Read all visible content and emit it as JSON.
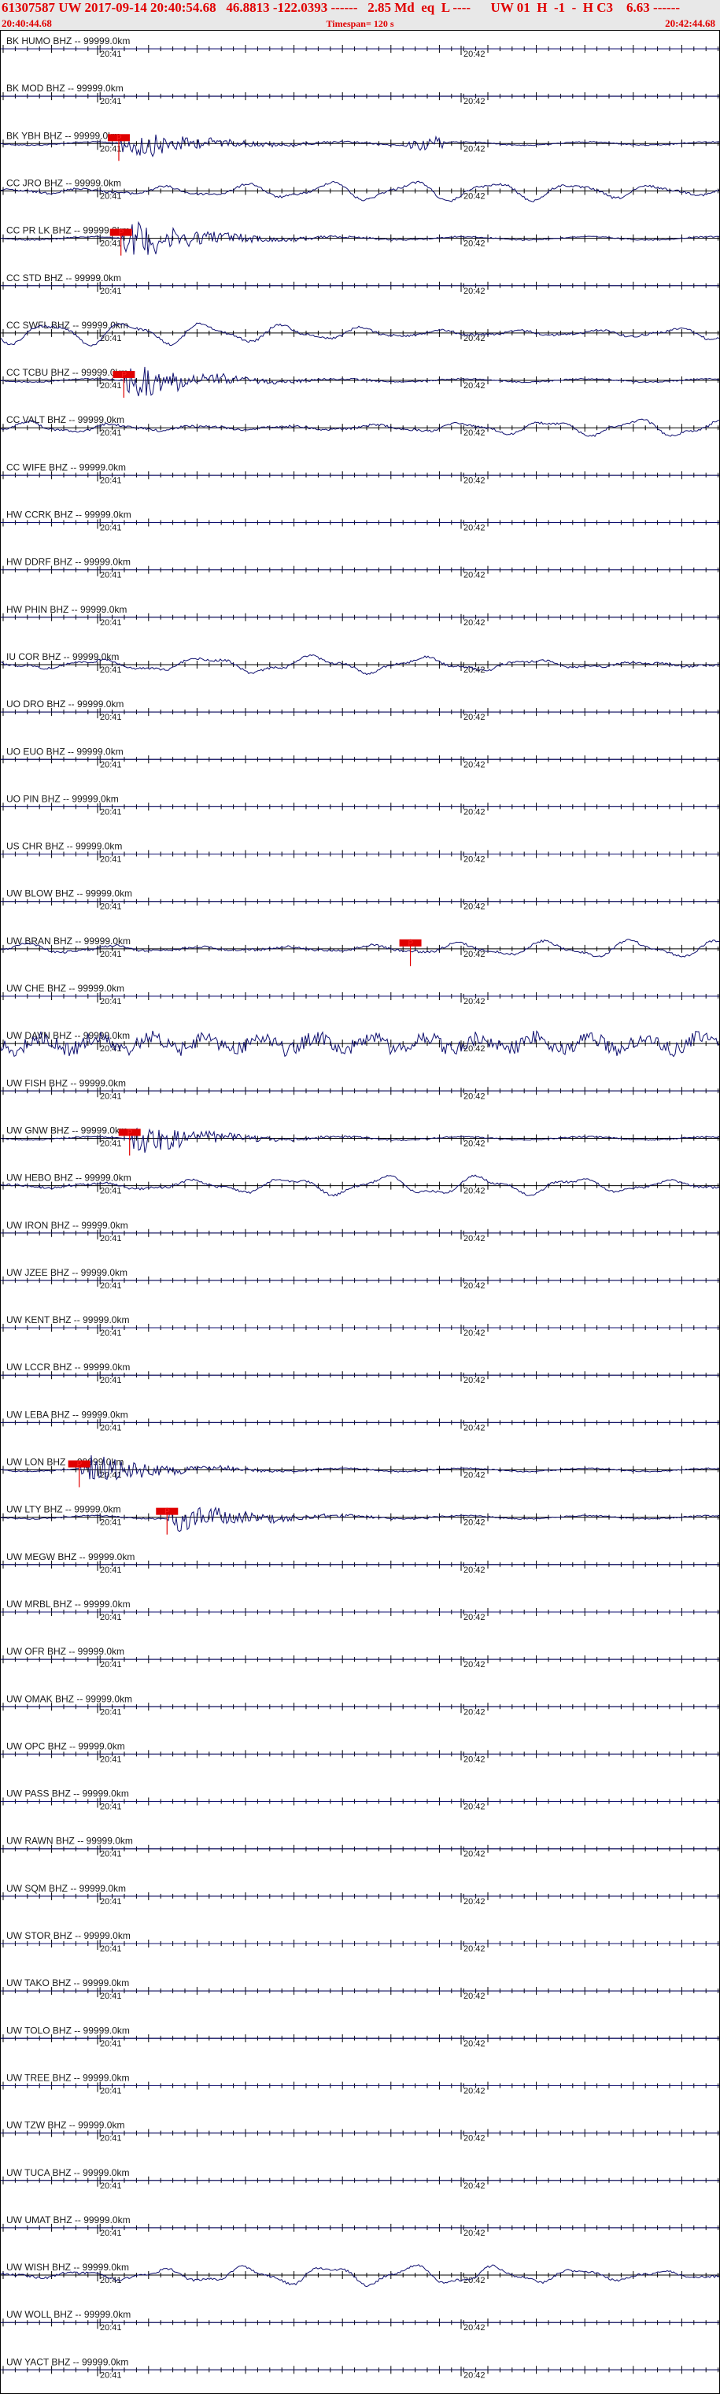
{
  "header": {
    "line1": "61307587 UW 2017-09-14 20:40:54.68   46.8813 -122.0393 ------   2.85 Md  eq  L ----      UW 01  H  -1  -  H C3    6.63 ------",
    "start_time": "20:40:44.68",
    "timespan": "Timespan= 120 s",
    "end_time": "20:42:44.68"
  },
  "colors": {
    "trace": "#101070",
    "pick": "#e00000",
    "header_text": "#e00000",
    "header_bg": "#e8e8e8",
    "axis": "#000000"
  },
  "chart_data": {
    "type": "line",
    "x_unit": "time",
    "time_marks": [
      "20:41",
      "20:42"
    ],
    "channels": [
      {
        "label": "BK HUMO BHZ -- 99999.0km",
        "trace": "flat",
        "pick": null
      },
      {
        "label": "BK MOD BHZ -- 99999.0km",
        "trace": "flat",
        "pick": null
      },
      {
        "label": "BK YBH BHZ -- 99999.0km",
        "trace": "event",
        "amp": 14,
        "pick": 0.165,
        "pick_label": "P",
        "extra_pulse": 0.59
      },
      {
        "label": "CC JRO BHZ -- 99999.0km",
        "trace": "wave",
        "amp": 14,
        "pick": null
      },
      {
        "label": "CC PR LK BHZ -- 99999.0km",
        "trace": "event",
        "amp": 18,
        "pick": 0.168,
        "pick_label": "P"
      },
      {
        "label": "CC STD BHZ -- 99999.0km",
        "trace": "flat",
        "pick": null
      },
      {
        "label": "CC SWFL BHZ -- 99999.0km",
        "trace": "wave",
        "amp": 16,
        "pick": null
      },
      {
        "label": "CC TCBU BHZ -- 99999.0km",
        "trace": "event",
        "amp": 16,
        "pick": 0.172,
        "pick_label": "P"
      },
      {
        "label": "CC VALT BHZ -- 99999.0km",
        "trace": "wave",
        "amp": 12,
        "pick": null
      },
      {
        "label": "CC WIFE BHZ -- 99999.0km",
        "trace": "flat",
        "pick": null
      },
      {
        "label": "HW CCRK BHZ -- 99999.0km",
        "trace": "flat",
        "pick": null
      },
      {
        "label": "HW DDRF BHZ -- 99999.0km",
        "trace": "flat",
        "pick": null
      },
      {
        "label": "HW PHIN BHZ -- 99999.0km",
        "trace": "flat",
        "pick": null
      },
      {
        "label": "IU COR BHZ -- 99999.0km",
        "trace": "wave",
        "amp": 12,
        "pick": null
      },
      {
        "label": "UO DRO BHZ -- 99999.0km",
        "trace": "flat",
        "pick": null
      },
      {
        "label": "UO EUO BHZ -- 99999.0km",
        "trace": "flat",
        "pick": null
      },
      {
        "label": "UO PIN BHZ -- 99999.0km",
        "trace": "flat",
        "pick": null
      },
      {
        "label": "US CHR BHZ -- 99999.0km",
        "trace": "flat",
        "pick": null
      },
      {
        "label": "UW BLOW BHZ -- 99999.0km",
        "trace": "flat",
        "pick": null
      },
      {
        "label": "UW BRAN BHZ -- 99999.0km",
        "trace": "wave",
        "amp": 12,
        "pick": 0.57,
        "pick_label": "P"
      },
      {
        "label": "UW CHE BHZ -- 99999.0km",
        "trace": "flat",
        "pick": null
      },
      {
        "label": "UW DAVN BHZ -- 99999.0km",
        "trace": "noise",
        "amp": 16,
        "pick": null
      },
      {
        "label": "UW FISH BHZ -- 99999.0km",
        "trace": "flat",
        "pick": null
      },
      {
        "label": "UW GNW BHZ -- 99999.0km",
        "trace": "event",
        "amp": 14,
        "pick": 0.18,
        "pick_label": "P"
      },
      {
        "label": "UW HEBO BHZ -- 99999.0km",
        "trace": "wave",
        "amp": 14,
        "pick": null
      },
      {
        "label": "UW IRON BHZ -- 99999.0km",
        "trace": "flat",
        "pick": null
      },
      {
        "label": "UW JZEE BHZ -- 99999.0km",
        "trace": "flat",
        "pick": null
      },
      {
        "label": "UW KENT BHZ -- 99999.0km",
        "trace": "flat",
        "pick": null
      },
      {
        "label": "UW LCCR BHZ -- 99999.0km",
        "trace": "flat",
        "pick": null
      },
      {
        "label": "UW LEBA BHZ -- 99999.0km",
        "trace": "flat",
        "pick": null
      },
      {
        "label": "UW LON BHZ -- 99999.0km",
        "trace": "event",
        "amp": 14,
        "pick": 0.11,
        "pick_label": "P"
      },
      {
        "label": "UW LTY BHZ -- 99999.0km",
        "trace": "event",
        "amp": 14,
        "pick": 0.232,
        "pick_label": "P"
      },
      {
        "label": "UW MEGW BHZ -- 99999.0km",
        "trace": "flat",
        "pick": null
      },
      {
        "label": "UW MRBL BHZ -- 99999.0km",
        "trace": "flat",
        "pick": null
      },
      {
        "label": "UW OFR BHZ -- 99999.0km",
        "trace": "flat",
        "pick": null
      },
      {
        "label": "UW OMAK BHZ -- 99999.0km",
        "trace": "flat",
        "pick": null
      },
      {
        "label": "UW OPC BHZ -- 99999.0km",
        "trace": "flat",
        "pick": null
      },
      {
        "label": "UW PASS BHZ -- 99999.0km",
        "trace": "flat",
        "pick": null
      },
      {
        "label": "UW RAWN BHZ -- 99999.0km",
        "trace": "flat",
        "pick": null
      },
      {
        "label": "UW SQM BHZ -- 99999.0km",
        "trace": "flat",
        "pick": null
      },
      {
        "label": "UW STOR BHZ -- 99999.0km",
        "trace": "flat",
        "pick": null
      },
      {
        "label": "UW TAKO BHZ -- 99999.0km",
        "trace": "flat",
        "pick": null
      },
      {
        "label": "UW TOLO BHZ -- 99999.0km",
        "trace": "flat",
        "pick": null
      },
      {
        "label": "UW TREE BHZ -- 99999.0km",
        "trace": "flat",
        "pick": null
      },
      {
        "label": "UW TZW BHZ -- 99999.0km",
        "trace": "flat",
        "pick": null
      },
      {
        "label": "UW TUCA BHZ -- 99999.0km",
        "trace": "flat",
        "pick": null
      },
      {
        "label": "UW UMAT BHZ -- 99999.0km",
        "trace": "flat",
        "pick": null
      },
      {
        "label": "UW WISH BHZ -- 99999.0km",
        "trace": "wave",
        "amp": 14,
        "pick": null
      },
      {
        "label": "UW WOLL BHZ -- 99999.0km",
        "trace": "flat",
        "pick": null
      },
      {
        "label": "UW YACT BHZ -- 99999.0km",
        "trace": "flat",
        "pick": null
      }
    ]
  }
}
